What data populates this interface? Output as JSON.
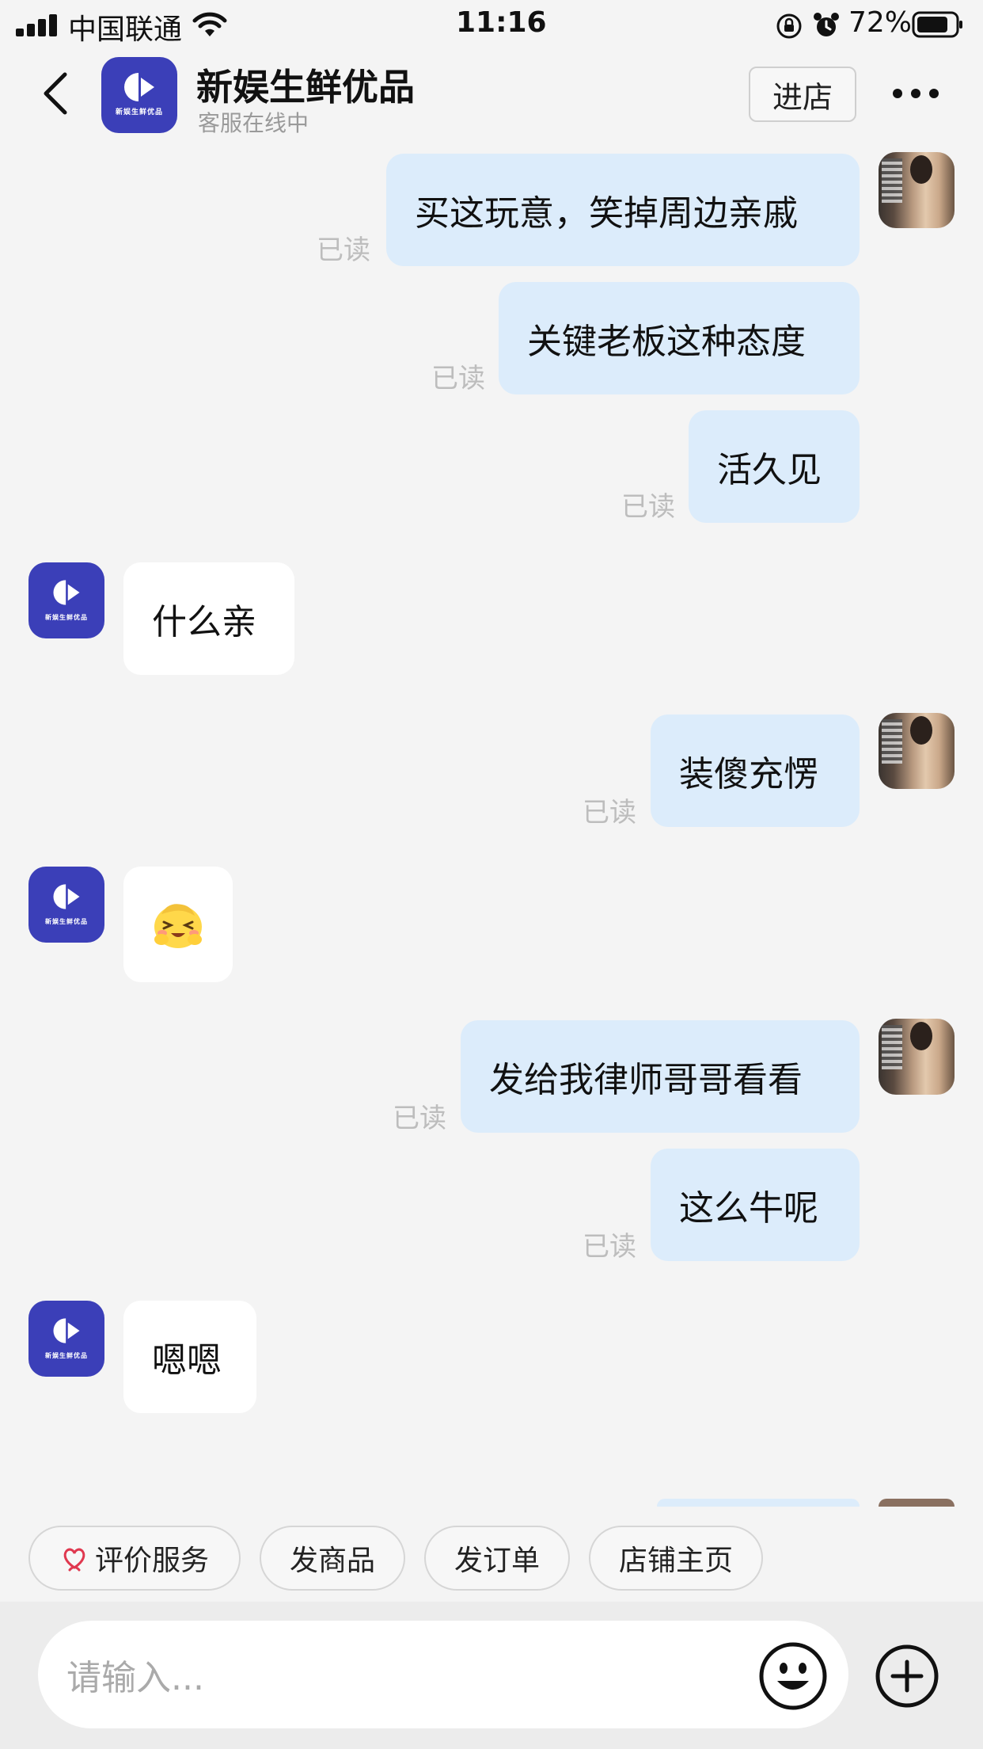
{
  "status_bar": {
    "carrier": "中国联通",
    "time": "11:16",
    "battery": "72%"
  },
  "header": {
    "shop_name": "新娱生鲜优品",
    "status": "客服在线中",
    "enter_label": "进店",
    "logo_text": "新娱生鲜优品"
  },
  "messages": [
    {
      "from": "me",
      "text": "买这玩意，笑掉周边亲戚",
      "read": "已读"
    },
    {
      "from": "me",
      "text": "关键老板这种态度",
      "read": "已读"
    },
    {
      "from": "me",
      "text": "活久见",
      "read": "已读"
    },
    {
      "from": "shop",
      "text": "什么亲"
    },
    {
      "from": "me",
      "text": "装傻充愣",
      "read": "已读"
    },
    {
      "from": "shop",
      "emoji": "shy-smile-emoji"
    },
    {
      "from": "me",
      "text": "发给我律师哥哥看看",
      "read": "已读"
    },
    {
      "from": "me",
      "text": "这么牛呢",
      "read": "已读"
    },
    {
      "from": "shop",
      "text": "嗯嗯"
    }
  ],
  "quick_actions": [
    {
      "label": "评价服务",
      "icon": "heart-hands-icon"
    },
    {
      "label": "发商品"
    },
    {
      "label": "发订单"
    },
    {
      "label": "店铺主页"
    }
  ],
  "input": {
    "placeholder": "请输入..."
  },
  "colors": {
    "my_bubble": "#dcecfb",
    "shop_bubble": "#ffffff",
    "brand": "#3b3fb8",
    "background": "#f4f4f4"
  }
}
